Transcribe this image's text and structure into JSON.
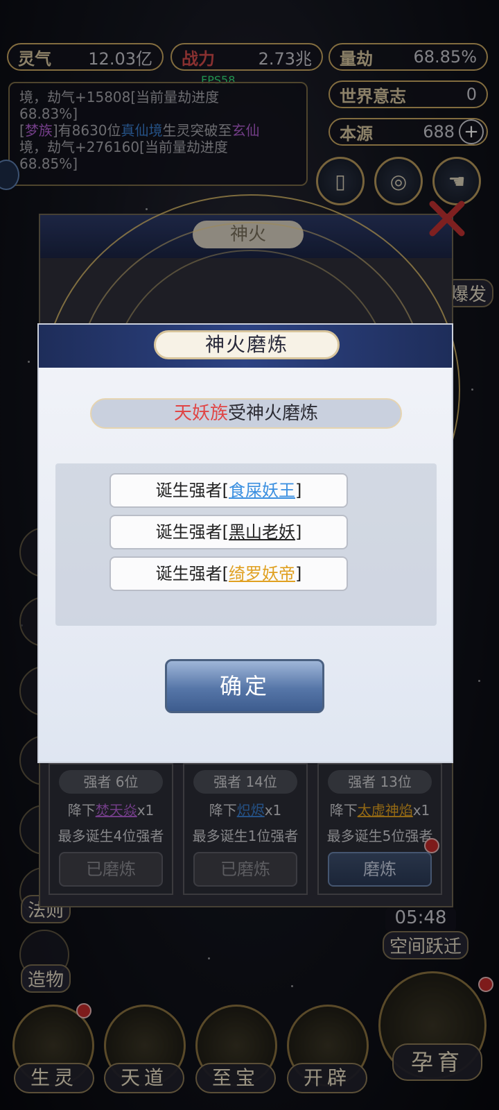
{
  "stats": {
    "lingqi": {
      "label": "灵气",
      "value": "12.03亿"
    },
    "zhanli": {
      "label": "战力",
      "value": "2.73兆"
    },
    "liangjie": {
      "label": "量劫",
      "value": "68.85%"
    },
    "world_will": {
      "label": "世界意志",
      "value": "0"
    },
    "benyuan": {
      "label": "本源",
      "value": "688"
    }
  },
  "fps": "FPS58",
  "log": {
    "line1": "境，劫气+15808[当前量劫进度",
    "line2": "68.83%]",
    "line3_pre": "[",
    "line3_race": "梦族",
    "line3_mid": "]有8630位",
    "line3_realm": "真仙境",
    "line3_post": "生灵突破至",
    "line3_realm2": "玄仙",
    "line4": "境，劫气+276160[当前量劫进度",
    "line5": "68.85%]"
  },
  "side_menu": [
    {
      "label": "法则"
    },
    {
      "label": "造物"
    }
  ],
  "right_labels": {
    "burst": "爆发",
    "timer": "05:48",
    "space_jump": "空间跃迁"
  },
  "bottom_nav": [
    {
      "label": "生灵"
    },
    {
      "label": "天道"
    },
    {
      "label": "至宝"
    },
    {
      "label": "开辟"
    },
    {
      "label": "孕育"
    }
  ],
  "background_panel": {
    "title": "神火",
    "cards": [
      {
        "count": "强者 6位",
        "desc_pre": "降下",
        "fire": "焚天焱",
        "desc_post": "x1",
        "limit": "最多诞生4位强者",
        "button": "已磨炼",
        "fire_color": "#b05fd0"
      },
      {
        "count": "强者 14位",
        "desc_pre": "降下",
        "fire": "炽烬",
        "desc_post": "x1",
        "limit": "最多诞生1位强者",
        "button": "已磨炼",
        "fire_color": "#3a7fd0"
      },
      {
        "count": "强者 13位",
        "desc_pre": "降下",
        "fire": "太虚神焰",
        "desc_post": "x1",
        "limit": "最多诞生5位强者",
        "button": "磨炼",
        "fire_color": "#e0a020"
      }
    ]
  },
  "dialog": {
    "title": "神火磨炼",
    "race": "天妖族",
    "subtitle_post": "受神火磨炼",
    "items": [
      {
        "prefix": "诞生强者[",
        "name": "食屎妖王",
        "suffix": "]",
        "color": "#3a8fe0"
      },
      {
        "prefix": "诞生强者[",
        "name": "黑山老妖",
        "suffix": "]",
        "color": "#222222"
      },
      {
        "prefix": "诞生强者[",
        "name": "绮罗妖帝",
        "suffix": "]",
        "color": "#e0a020"
      }
    ],
    "confirm": "确定"
  }
}
